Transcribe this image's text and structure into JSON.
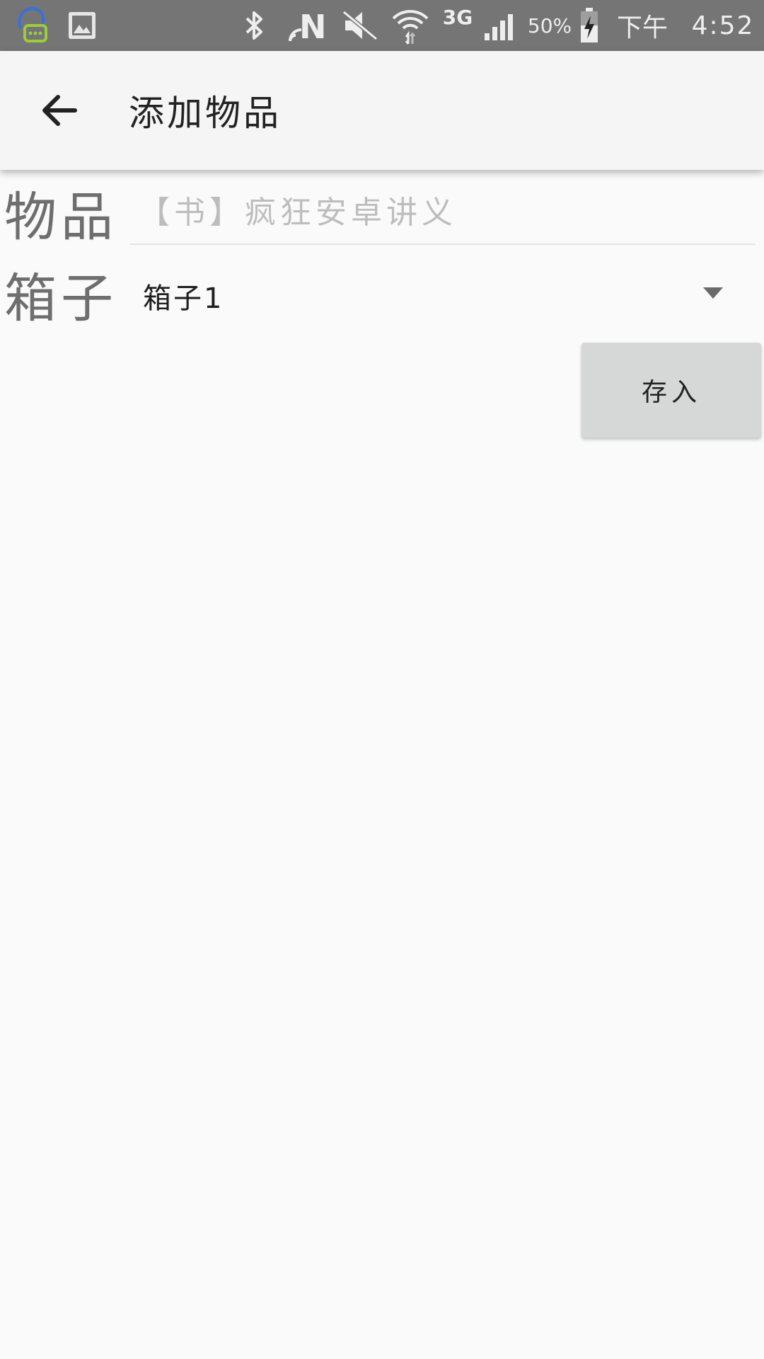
{
  "status_bar": {
    "icons": [
      "chat-notification-icon",
      "gallery-icon",
      "bluetooth-icon",
      "nfc-icon",
      "mute-icon",
      "wifi-icon",
      "signal-icon",
      "battery-charging-icon"
    ],
    "network": "3G",
    "battery": "50%",
    "period": "下午",
    "time": "4:52"
  },
  "toolbar": {
    "back_icon": "arrow-back-icon",
    "title": "添加物品"
  },
  "form": {
    "item_label": "物品",
    "item_placeholder": "【书】疯狂安卓讲义",
    "item_value": "",
    "box_label": "箱子",
    "box_selected": "箱子1",
    "store_label": "存入"
  },
  "colors": {
    "status_bar": "#757575",
    "toolbar": "#f5f5f5",
    "background": "#fafafa",
    "button": "#d6d7d7",
    "label": "#6e6e6e"
  }
}
